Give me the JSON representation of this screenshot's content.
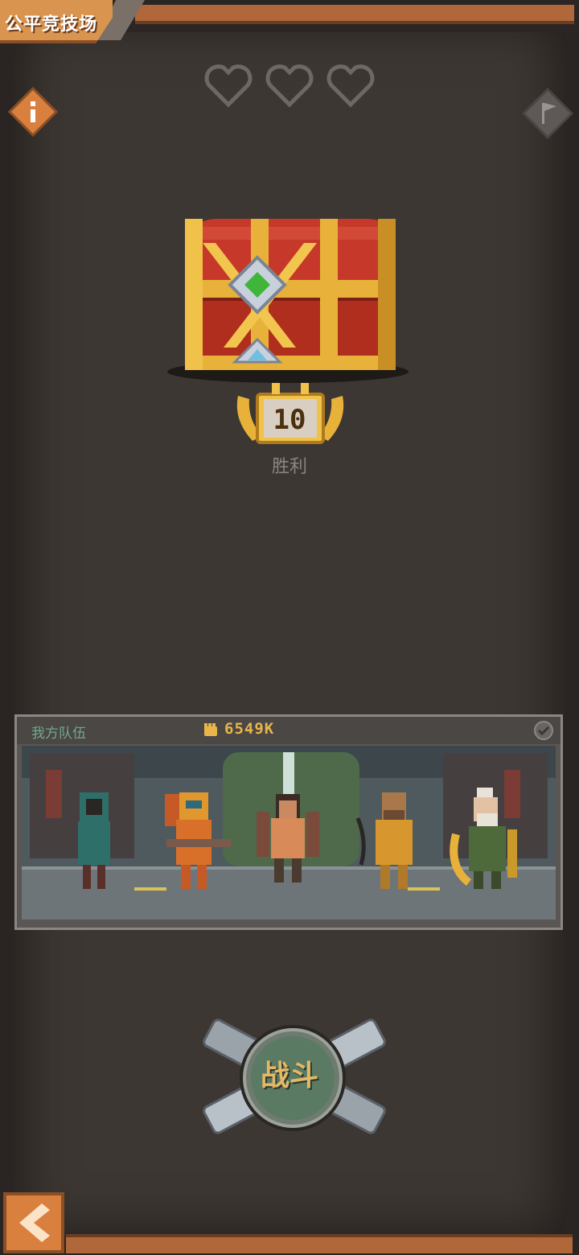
{
  "header": {
    "title": "公平竞技场"
  },
  "lives": {
    "hearts": [
      "empty",
      "empty",
      "empty"
    ]
  },
  "icons": {
    "info": "info-icon",
    "flag": "flag-icon",
    "back": "chevron-left-icon",
    "power": "fist-icon",
    "check": "check-circle-icon"
  },
  "reward": {
    "chest": "treasure-chest",
    "wins_required": "10",
    "wins_label": "胜利"
  },
  "team": {
    "title": "我方队伍",
    "power": "6549K",
    "members": [
      "hooded-scout",
      "armored-flamethrower",
      "twin-gunner",
      "crossbow-hunter",
      "elder-mage"
    ]
  },
  "actions": {
    "fight_label": "战斗"
  },
  "colors": {
    "accent_orange": "#d9944f",
    "panel_bg": "#3d3733",
    "power_gold": "#e8b54a",
    "team_title_green": "#6fa88a",
    "fight_button": "#5a7a63"
  }
}
